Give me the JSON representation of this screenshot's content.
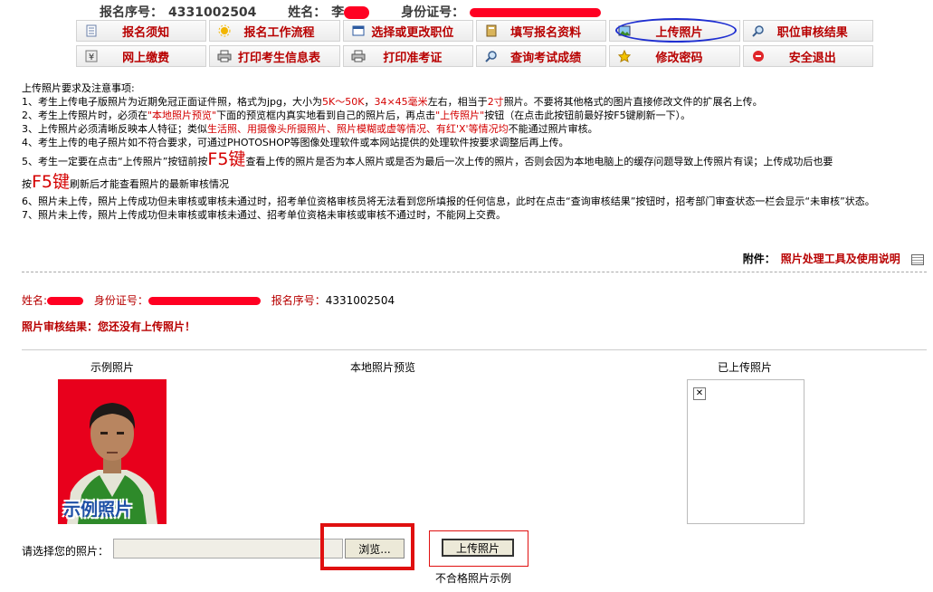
{
  "header": {
    "reg_label": "报名序号：",
    "reg_no": "4331002504",
    "name_label": "姓名：",
    "name_prefix": "李",
    "id_label": "身份证号："
  },
  "nav": {
    "row1": [
      {
        "label": "报名须知",
        "icon": "document-icon"
      },
      {
        "label": "报名工作流程",
        "icon": "sun-icon"
      },
      {
        "label": "选择或更改职位",
        "icon": "window-icon"
      },
      {
        "label": "填写报名资料",
        "icon": "book-icon"
      },
      {
        "label": "上传照片",
        "icon": "picture-icon"
      },
      {
        "label": "职位审核结果",
        "icon": "search-icon"
      }
    ],
    "row2": [
      {
        "label": "网上缴费",
        "icon": "yen-icon"
      },
      {
        "label": "打印考生信息表",
        "icon": "printer-icon"
      },
      {
        "label": "打印准考证",
        "icon": "printer-icon"
      },
      {
        "label": "查询考试成绩",
        "icon": "search-icon"
      },
      {
        "label": "修改密码",
        "icon": "star-icon"
      },
      {
        "label": "安全退出",
        "icon": "stop-icon"
      }
    ]
  },
  "notes": {
    "title": "上传照片要求及注意事项:",
    "n1a": "1、考生上传电子版照片为近期免冠正面证件照，格式为jpg，大小为",
    "n1b": "5K～50K",
    "n1c": "，",
    "n1d": "34×45毫米",
    "n1e": "左右，相当于",
    "n1f": "2寸",
    "n1g": "照片。不要将其他格式的图片直接修改文件的扩展名上传。",
    "n2a": "2、考生上传照片时，必须在",
    "n2b": "\"本地照片预览\"",
    "n2c": "下面的预览框内真实地看到自己的照片后，再点击",
    "n2d": "\"上传照片\"",
    "n2e": "按钮（在点击此按钮前最好按F5键刷新一下）。",
    "n3a": "3、上传照片必须清晰反映本人特征；类似",
    "n3b": "生活照、用摄像头所摄照片、照片模糊或虚等情况、有红'X'等情况均",
    "n3c": "不能通过照片审核。",
    "n4": "4、考生上传的电子照片如不符合要求，可通过PHOTOSHOP等图像处理软件或本网站提供的处理软件按要求调整后再上传。",
    "n5a": "5、考生一定要在点击“上传照片”按钮前按",
    "n5b": "F5键",
    "n5c": "查看上传的照片是否为本人照片或是否为最后一次上传的照片，否则会因为本地电脑上的缓存问题导致上传照片有误；上传成功后也要",
    "n5d": "按",
    "n5e": "F5键",
    "n5f": "刷新后才能查看照片的最新审核情况",
    "n6": "6、照片未上传，照片上传成功但未审核或审核未通过时，招考单位资格审核员将无法看到您所填报的任何信息，此时在点击“查询审核结果”按钮时，招考部门审查状态一栏会显示“未审核”状态。",
    "n7": "7、照片未上传，照片上传成功但未审核或审核未通过、招考单位资格未审核或审核不通过时，不能网上交费。"
  },
  "attach": {
    "label": "附件：",
    "link": "照片处理工具及使用说明"
  },
  "candidate": {
    "name_label": "姓名:",
    "id_label": "身份证号：",
    "reg_label": "报名序号：",
    "reg_no": "4331002504",
    "result": "照片审核结果：您还没有上传照片！"
  },
  "photos": {
    "sample_head": "示例照片",
    "local_head": "本地照片预览",
    "uploaded_head": "已上传照片",
    "sample_caption": "示例照片"
  },
  "upload": {
    "choose_label": "请选择您的照片：",
    "browse": "浏览...",
    "upload_btn": "上传照片",
    "bad_sample": "不合格照片示例"
  },
  "colors": {
    "accent": "#b80000",
    "highlight": "#e01010",
    "ellipse": "#1f2fd1"
  }
}
